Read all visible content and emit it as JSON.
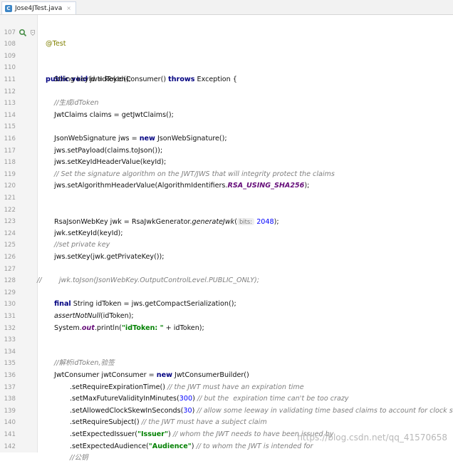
{
  "tab": {
    "title": "Jose4JTest.java",
    "close": "×"
  },
  "watermark": "https://blog.csdn.net/qq_41570658",
  "lines": [
    {
      "num": "107",
      "text": "@Test"
    },
    {
      "num": "108",
      "a": "public void",
      "b": " jwtIdTokenConsumer() ",
      "c": "throws",
      "d": " Exception {"
    },
    {
      "num": "109",
      "text": ""
    },
    {
      "num": "110",
      "text": "String keyId = keyId();"
    },
    {
      "num": "111",
      "text": ""
    },
    {
      "num": "112",
      "text": "//生成idToken"
    },
    {
      "num": "113",
      "text": "JwtClaims claims = getJwtClaims();"
    },
    {
      "num": "114",
      "text": ""
    },
    {
      "num": "115",
      "a": "JsonWebSignature jws = ",
      "b": "new",
      "c": " JsonWebSignature();"
    },
    {
      "num": "116",
      "text": "jws.setPayload(claims.toJson());"
    },
    {
      "num": "117",
      "text": "jws.setKeyIdHeaderValue(keyId);"
    },
    {
      "num": "118",
      "text": "// Set the signature algorithm on the JWT/JWS that will integrity protect the claims"
    },
    {
      "num": "119",
      "a": "jws.setAlgorithmHeaderValue(AlgorithmIdentifiers.",
      "b": "RSA_USING_SHA256",
      "c": ");"
    },
    {
      "num": "120",
      "text": ""
    },
    {
      "num": "121",
      "text": ""
    },
    {
      "num": "122",
      "a": "RsaJsonWebKey jwk = RsaJwkGenerator.",
      "b": "generateJwk",
      "c": "(",
      "hint": "bits:",
      "d": "2048",
      "e": ");"
    },
    {
      "num": "123",
      "text": "jwk.setKeyId(keyId);"
    },
    {
      "num": "124",
      "text": "//set private key"
    },
    {
      "num": "125",
      "text": "jws.setKey(jwk.getPrivateKey());"
    },
    {
      "num": "126",
      "text": ""
    },
    {
      "num": "127",
      "text": "//        jwk.toJson(JsonWebKey.OutputControlLevel.PUBLIC_ONLY);"
    },
    {
      "num": "128",
      "text": ""
    },
    {
      "num": "129",
      "a": "final",
      "b": " String idToken = jws.getCompactSerialization();"
    },
    {
      "num": "130",
      "a": "assertNotNull",
      "b": "(idToken);"
    },
    {
      "num": "131",
      "a": "System.",
      "b": "out",
      "c": ".println(",
      "d": "\"idToken: \"",
      "e": " + idToken);"
    },
    {
      "num": "132",
      "text": ""
    },
    {
      "num": "133",
      "text": ""
    },
    {
      "num": "134",
      "text": "//解析idToken,验签"
    },
    {
      "num": "135",
      "a": "JwtConsumer jwtConsumer = ",
      "b": "new",
      "c": " JwtConsumerBuilder()"
    },
    {
      "num": "136",
      "a": ".setRequireExpirationTime() ",
      "b": "// the JWT must have an expiration time"
    },
    {
      "num": "137",
      "a": ".setMaxFutureValidityInMinutes(",
      "b": "300",
      "c": ") ",
      "d": "// but the  expiration time can't be too crazy"
    },
    {
      "num": "138",
      "a": ".setAllowedClockSkewInSeconds(",
      "b": "30",
      "c": ") ",
      "d": "// allow some leeway in validating time based claims to account for clock skew"
    },
    {
      "num": "139",
      "a": ".setRequireSubject() ",
      "b": "// the JWT must have a subject claim"
    },
    {
      "num": "140",
      "a": ".setExpectedIssuer(",
      "b": "\"Issuer\"",
      "c": ") ",
      "d": "// whom the JWT needs to have been issued by"
    },
    {
      "num": "141",
      "a": ".setExpectedAudience(",
      "b": "\"Audience\"",
      "c": ") ",
      "d": "// to whom the JWT is intended for"
    },
    {
      "num": "142",
      "text": "//公钥"
    }
  ]
}
